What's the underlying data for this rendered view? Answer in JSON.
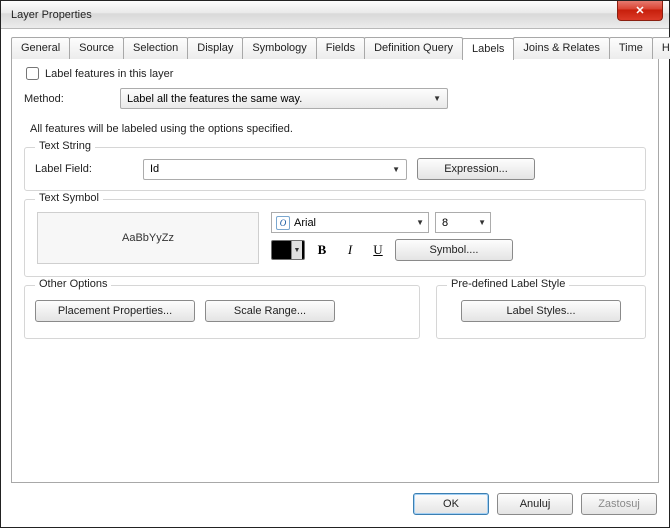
{
  "window": {
    "title": "Layer Properties",
    "close_glyph": "✕"
  },
  "tabs": [
    "General",
    "Source",
    "Selection",
    "Display",
    "Symbology",
    "Fields",
    "Definition Query",
    "Labels",
    "Joins & Relates",
    "Time",
    "HTML Popup"
  ],
  "active_tab": "Labels",
  "checkbox": {
    "label": "Label features in this layer",
    "checked": false
  },
  "method": {
    "label": "Method:",
    "value": "Label all the features the same way."
  },
  "description": "All features will be labeled using the options specified.",
  "textstring": {
    "legend": "Text String",
    "label_field_label": "Label Field:",
    "label_field_value": "Id",
    "expression_btn": "Expression..."
  },
  "textsymbol": {
    "legend": "Text Symbol",
    "preview": "AaBbYyZz",
    "font": "Arial",
    "size": "8",
    "symbol_btn": "Symbol...."
  },
  "other_options": {
    "legend": "Other Options",
    "placement_btn": "Placement Properties...",
    "scale_btn": "Scale Range..."
  },
  "predefined": {
    "legend": "Pre-defined Label Style",
    "styles_btn": "Label Styles..."
  },
  "footer": {
    "ok": "OK",
    "cancel": "Anuluj",
    "apply": "Zastosuj"
  }
}
